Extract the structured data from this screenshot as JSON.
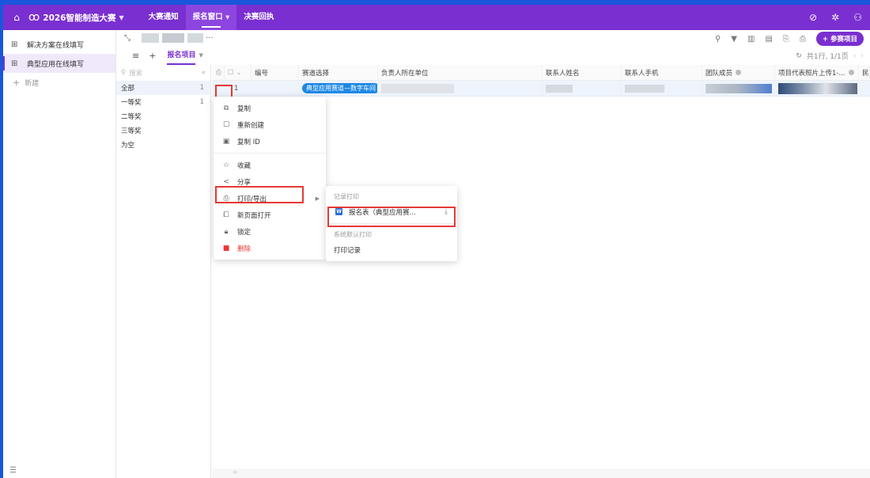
{
  "topbar": {
    "app_title": "2026智能制造大赛",
    "nav": [
      {
        "label": "大赛通知"
      },
      {
        "label": "报名窗口"
      },
      {
        "label": "决赛回执"
      }
    ]
  },
  "sidebar": {
    "items": [
      {
        "label": "解决方案在线填写"
      },
      {
        "label": "典型应用在线填写"
      }
    ],
    "new_label": "新建"
  },
  "view": {
    "tab_label": "报名项目",
    "add_button": "+ 参赛项目",
    "pagination": "共1行, 1/1页"
  },
  "groups": {
    "search_placeholder": "搜索",
    "items": [
      {
        "label": "全部",
        "count": "1"
      },
      {
        "label": "一等奖",
        "count": "1"
      },
      {
        "label": "二等奖",
        "count": ""
      },
      {
        "label": "三等奖",
        "count": ""
      },
      {
        "label": "为空",
        "count": ""
      }
    ]
  },
  "grid": {
    "columns": [
      "编号",
      "赛道选择",
      "负责人所在单位",
      "联系人姓名",
      "联系人手机",
      "团队成员",
      "项目代表照片上传1-..."
    ],
    "last_col_char": "民",
    "row": {
      "id": "1",
      "track": "典型应用赛道—数字车间"
    }
  },
  "context_menu": {
    "items": [
      {
        "label": "复制"
      },
      {
        "label": "重新创建"
      },
      {
        "label": "复制 ID"
      },
      {
        "label": "收藏"
      },
      {
        "label": "分享"
      },
      {
        "label": "打印/导出"
      },
      {
        "label": "新页面打开"
      },
      {
        "label": "锁定"
      },
      {
        "label": "删除"
      }
    ]
  },
  "submenu": {
    "section1": "记录打印",
    "template": "报名表（典型应用赛...",
    "section2": "系统默认打印",
    "history": "打印记录"
  },
  "colors": {
    "brand": "#7a2fd0",
    "tag": "#1e88e5",
    "danger": "#e53935"
  }
}
